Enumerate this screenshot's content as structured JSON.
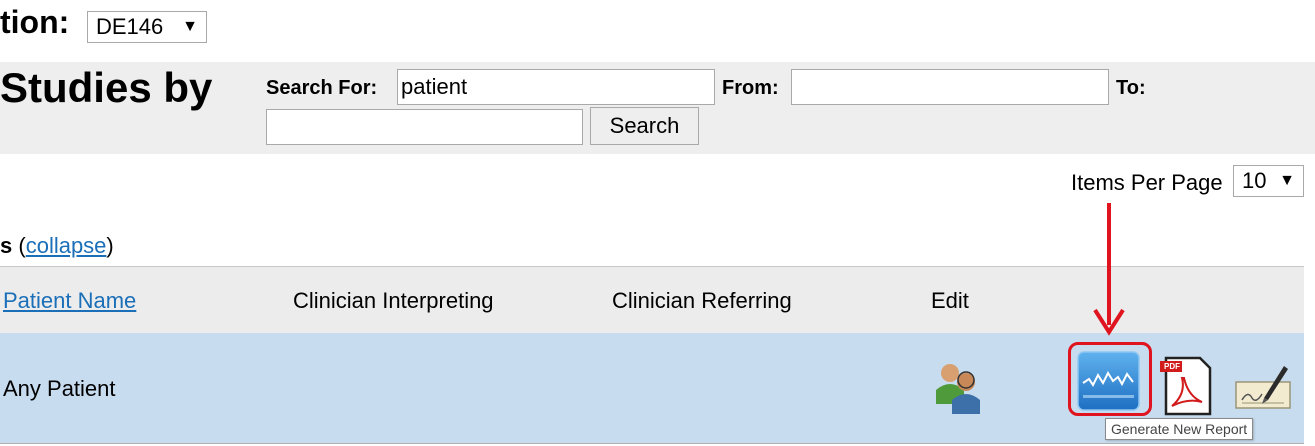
{
  "location": {
    "label": "tion:",
    "selected": "DE146",
    "arrow": "▼"
  },
  "search_band": {
    "title": "Studies by",
    "search_for_label": "Search For:",
    "search_value": "patient",
    "from_label": "From:",
    "from_value": "",
    "to_label": "To:",
    "to_value": "",
    "search_button": "Search"
  },
  "pagination": {
    "items_per_page_label": "Items Per Page",
    "items_per_page_value": "10",
    "arrow": "▼"
  },
  "results": {
    "section_prefix": "s",
    "open_paren": "(",
    "collapse_link": "collapse",
    "close_paren": ")",
    "columns": [
      "Patient Name",
      "Clinician Interpreting",
      "Clinician Referring",
      "Edit"
    ],
    "rows": [
      {
        "patient_name": "Any Patient",
        "actions": [
          "edit-users-icon",
          "generate-report-icon",
          "pdf-icon",
          "sign-icon"
        ]
      }
    ]
  },
  "icons": {
    "pdf_badge": "PDF"
  },
  "tooltip": "Generate New Report",
  "colors": {
    "band_background": "#eeeeee",
    "row_highlight": "#c7dcef",
    "link": "#1a6fb8",
    "annotation_red": "#e0141e"
  }
}
